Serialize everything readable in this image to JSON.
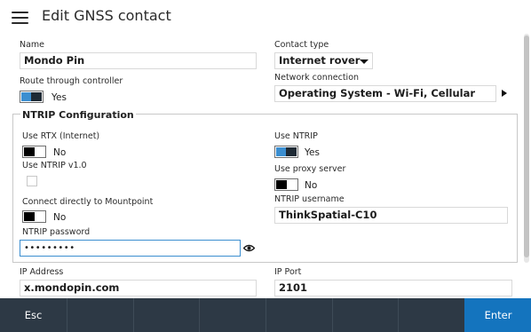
{
  "header": {
    "title": "Edit GNSS contact"
  },
  "name": {
    "label": "Name",
    "value": "Mondo Pin"
  },
  "contact_type": {
    "label": "Contact type",
    "value": "Internet rover"
  },
  "route_through_controller": {
    "label": "Route through controller",
    "state": "Yes",
    "on": true
  },
  "network_connection": {
    "label": "Network connection",
    "value": "Operating System - Wi-Fi, Cellular"
  },
  "ntrip": {
    "title": "NTRIP Configuration",
    "use_rtx": {
      "label": "Use RTX (Internet)",
      "state": "No",
      "on": false
    },
    "use_ntrip_v1": {
      "label": "Use NTRIP v1.0",
      "checked": false
    },
    "connect_direct": {
      "label": "Connect directly to Mountpoint",
      "state": "No",
      "on": false
    },
    "password": {
      "label": "NTRIP password",
      "value": "•••••••••"
    },
    "use_ntrip": {
      "label": "Use NTRIP",
      "state": "Yes",
      "on": true
    },
    "use_proxy": {
      "label": "Use proxy server",
      "state": "No",
      "on": false
    },
    "username": {
      "label": "NTRIP username",
      "value": "ThinkSpatial-C10"
    }
  },
  "ip_address": {
    "label": "IP Address",
    "value": "x.mondopin.com"
  },
  "ip_port": {
    "label": "IP Port",
    "value": "2101"
  },
  "footer": {
    "esc_label": "Esc",
    "enter_label": "Enter"
  },
  "colors": {
    "accent": "#3b8ed0",
    "footer_bg": "#2d3945",
    "enter_bg": "#1474be"
  },
  "icons": {
    "menu": "hamburger-icon",
    "eye": "eye-icon",
    "caret": "caret-down-icon",
    "arrow": "arrow-right-icon"
  }
}
